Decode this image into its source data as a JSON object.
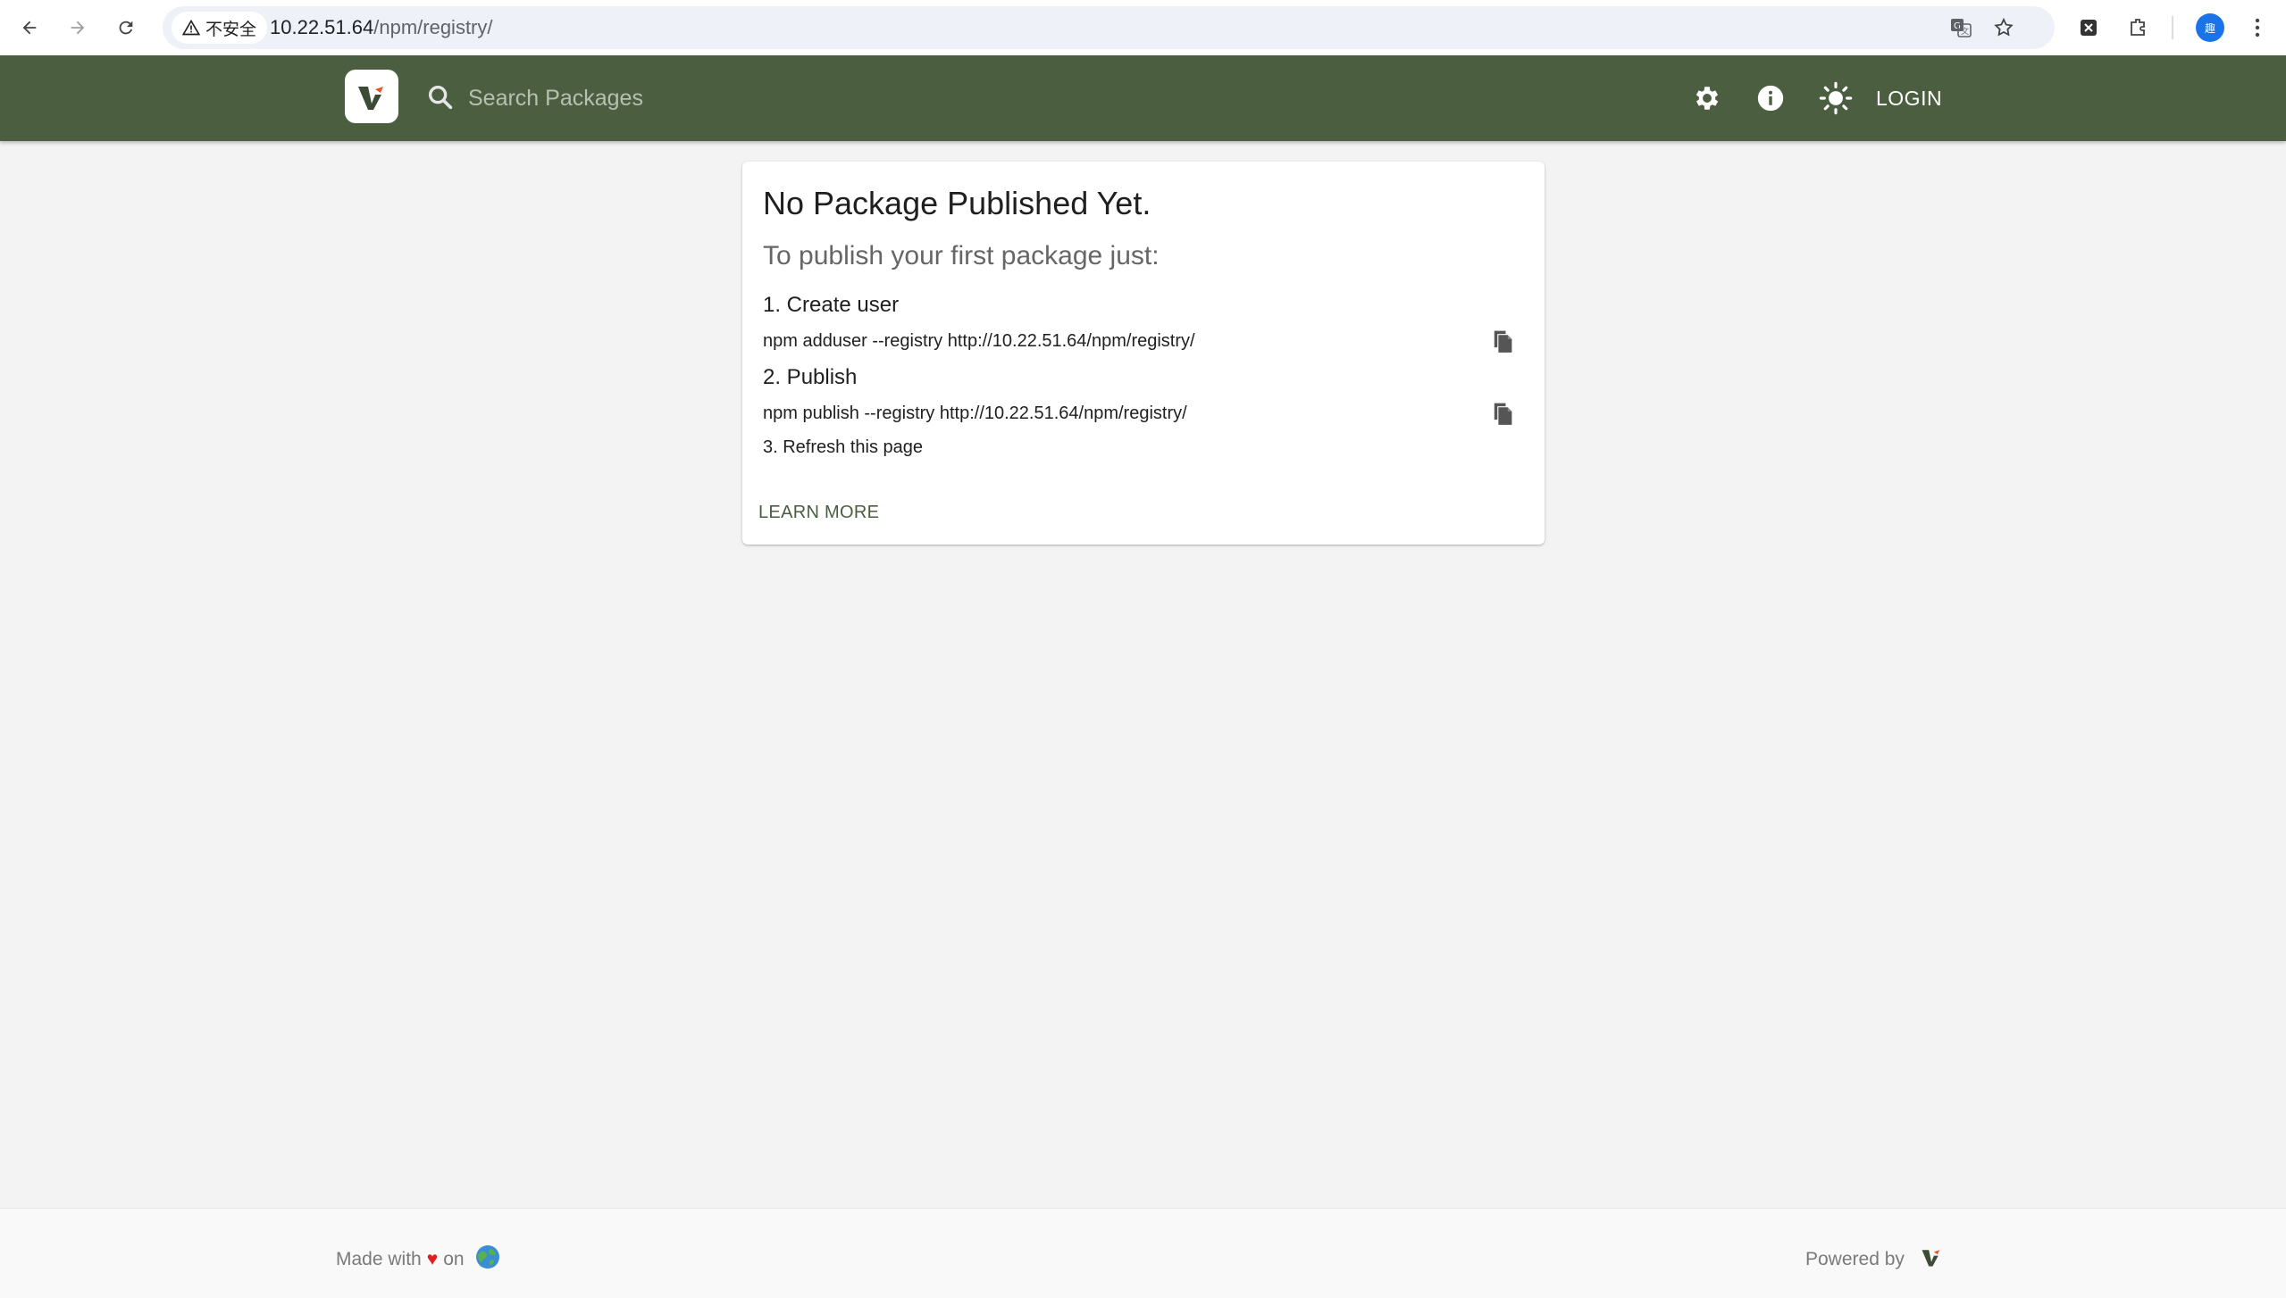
{
  "browser": {
    "security_label": "不安全",
    "url_host": "10.22.51.64",
    "url_path": "/npm/registry/",
    "profile_initial": "趣"
  },
  "header": {
    "search_placeholder": "Search Packages",
    "login_label": "LOGIN"
  },
  "card": {
    "title": "No Package Published Yet.",
    "subtitle": "To publish your first package just:",
    "step1": "1. Create user",
    "cmd1": "npm adduser --registry http://10.22.51.64/npm/registry/",
    "step2": "2. Publish",
    "cmd2": "npm publish --registry http://10.22.51.64/npm/registry/",
    "step3": "3. Refresh this page",
    "learn_more": "LEARN MORE"
  },
  "footer": {
    "made_with": "Made with",
    "heart": "♥",
    "on": "on",
    "powered_by": "Powered by"
  },
  "colors": {
    "header_bg": "#4b5e40",
    "accent_link": "#4b5e40",
    "logo_orange": "#e4572e",
    "heart": "#e11d1d"
  }
}
